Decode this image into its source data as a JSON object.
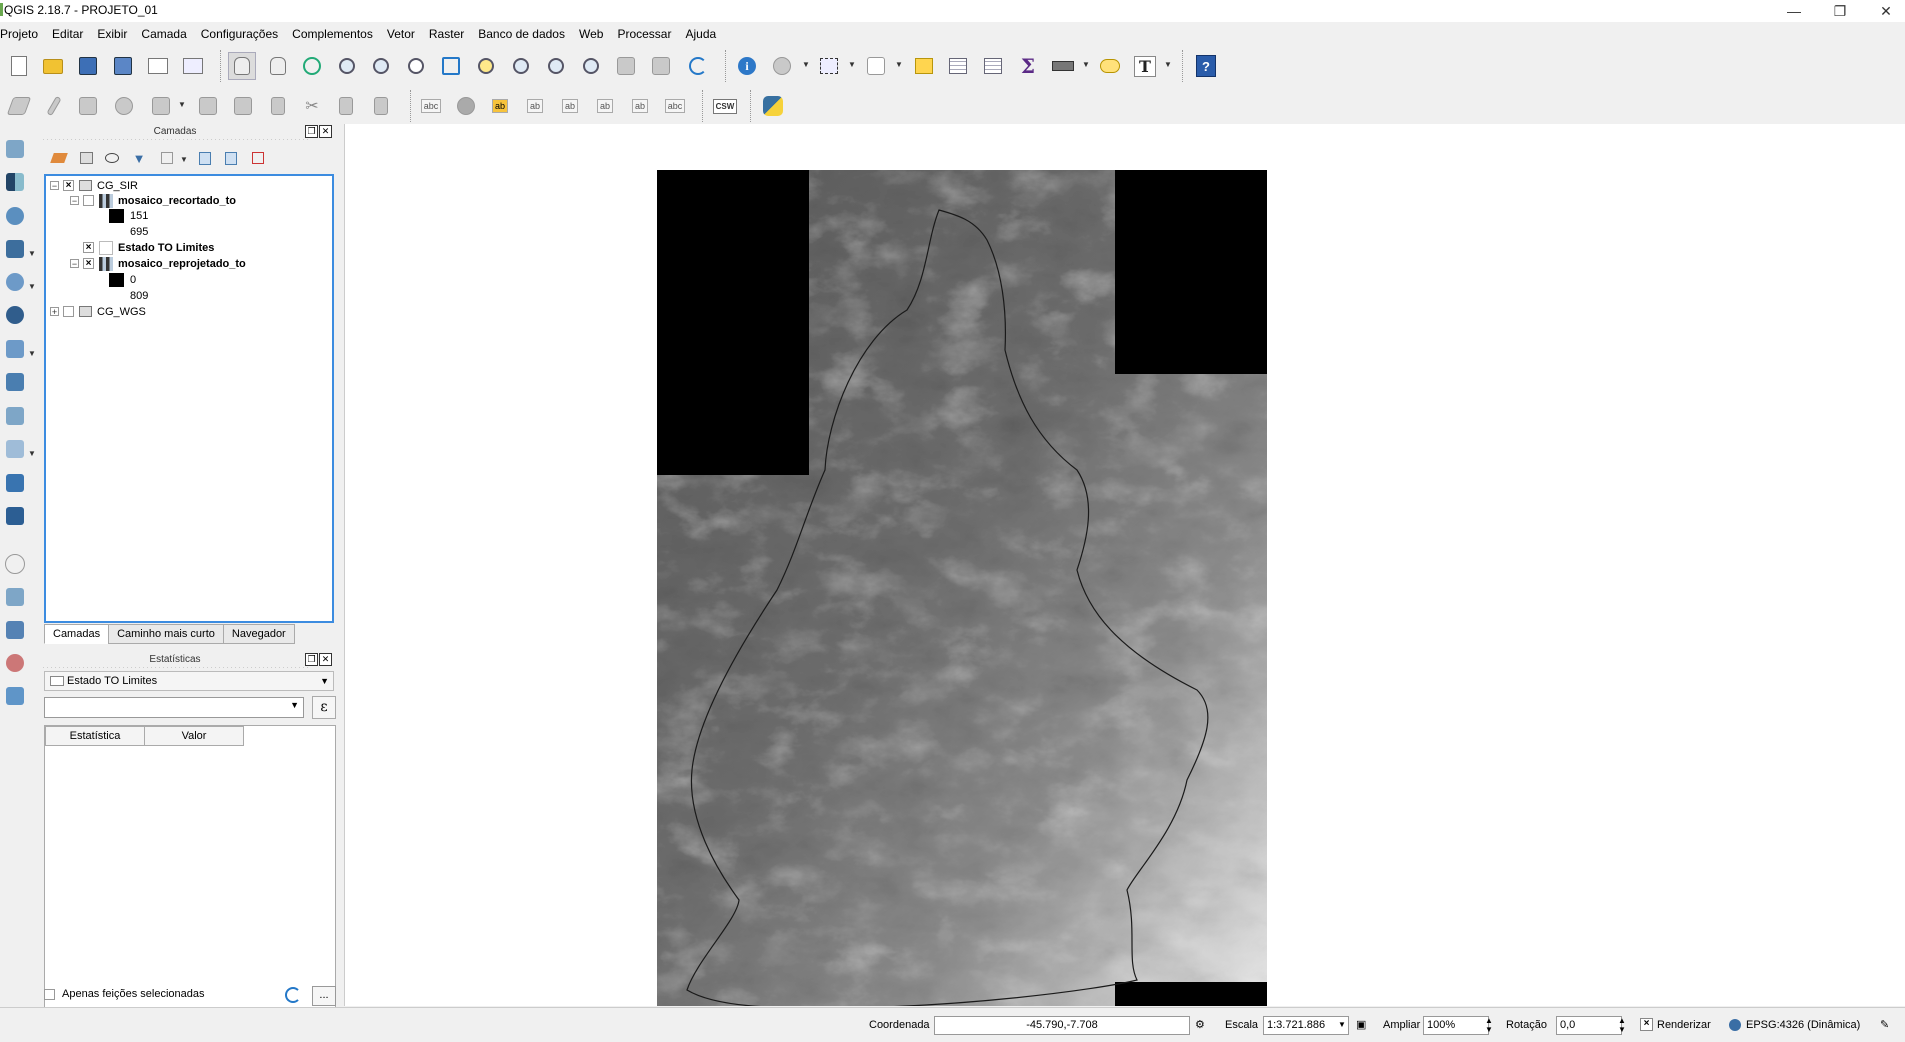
{
  "window": {
    "title": "QGIS 2.18.7 - PROJETO_01"
  },
  "menubar": [
    "Projeto",
    "Editar",
    "Exibir",
    "Camada",
    "Configurações",
    "Complementos",
    "Vetor",
    "Raster",
    "Banco de dados",
    "Web",
    "Processar",
    "Ajuda"
  ],
  "layers_panel": {
    "title": "Camadas",
    "tree": {
      "group1": "CG_SIR",
      "layer1": "mosaico_recortado_to",
      "layer1_min": "151",
      "layer1_max": "695",
      "layer2": "Estado TO Limites",
      "layer3": "mosaico_reprojetado_to",
      "layer3_min": "0",
      "layer3_max": "809",
      "group2": "CG_WGS"
    }
  },
  "tabs": [
    "Camadas",
    "Caminho mais curto",
    "Navegador"
  ],
  "stats_panel": {
    "title": "Estatísticas",
    "layer": "Estado TO Limites",
    "columns": [
      "Estatística",
      "Valor"
    ],
    "only_selected": "Apenas feições selecionadas",
    "more": "..."
  },
  "toolbar": {
    "csw": "CSW",
    "abc": "abc",
    "ab": "ab"
  },
  "statusbar": {
    "coord_label": "Coordenada",
    "coord_value": "-45.790,-7.708",
    "scale_label": "Escala",
    "scale_value": "1:3.721.886",
    "zoom_label": "Ampliar",
    "zoom_value": "100%",
    "rotation_label": "Rotação",
    "rotation_value": "0,0",
    "render_label": "Renderizar",
    "crs": "EPSG:4326 (Dinâmica)"
  },
  "colors": {
    "selection": "#3c8ce0",
    "background": "#f0f0f0"
  }
}
